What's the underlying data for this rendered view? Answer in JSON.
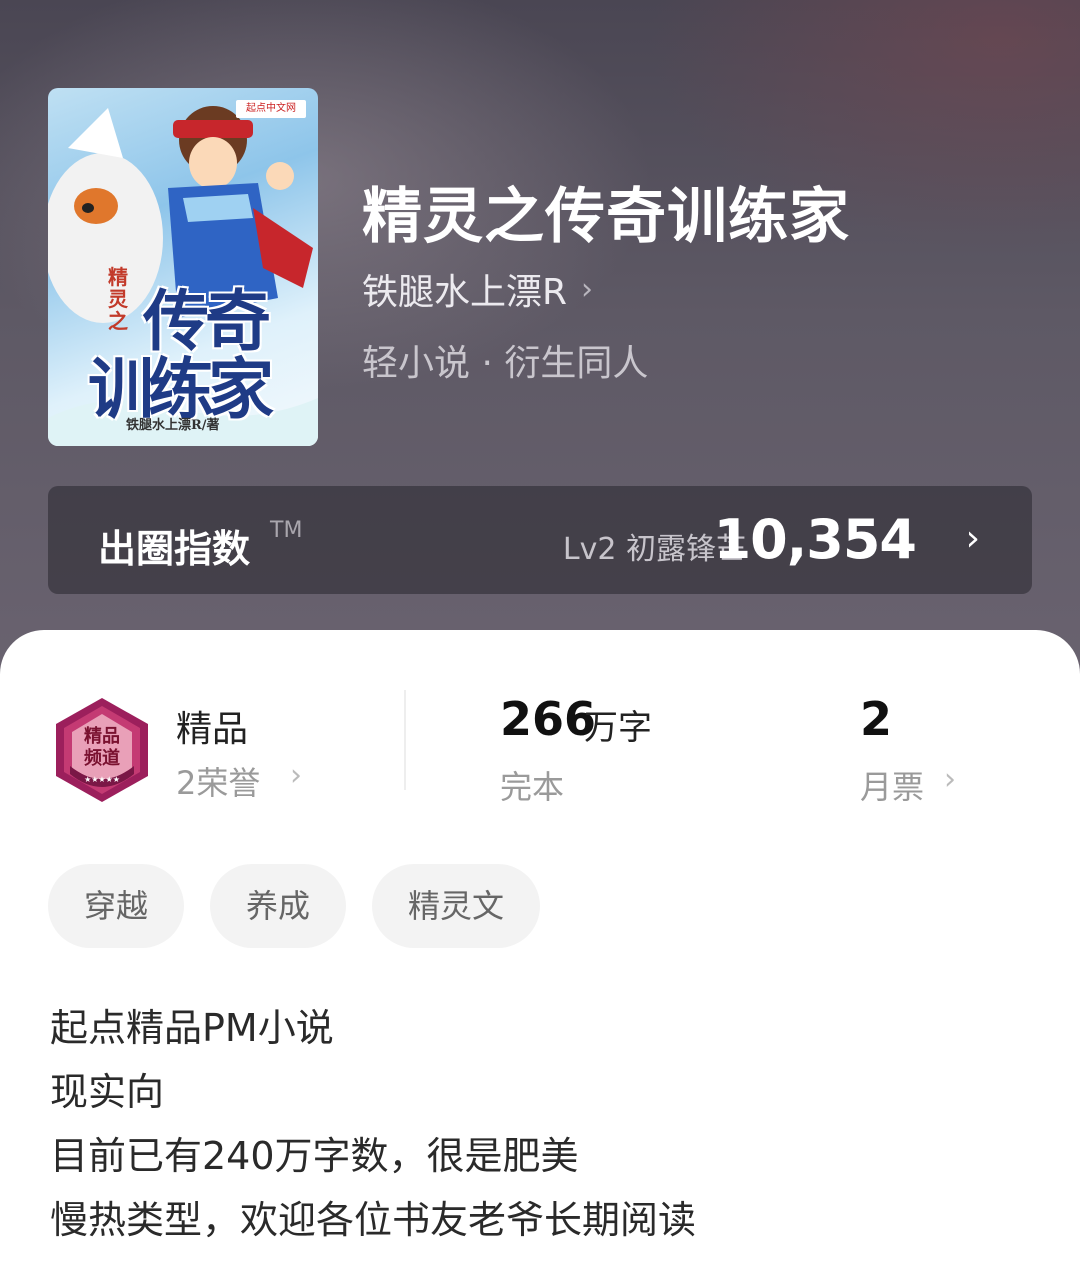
{
  "book": {
    "title": "精灵之传奇训练家",
    "author": "铁腿水上漂R",
    "genre": "轻小说 · 衍生同人"
  },
  "cover": {
    "publisher": "起点中文网",
    "small_title": "精灵之",
    "big_title_line1": "传奇",
    "big_title_line2": "训练家",
    "author_credit": "铁腿水上漂R/著"
  },
  "index": {
    "label": "出圈指数",
    "tm": "TM",
    "level": "Lv2 初露锋芒",
    "value": "10,354"
  },
  "stats": {
    "quality": {
      "label": "精品",
      "honors": "2荣誉",
      "badge_text": "精品频道"
    },
    "words": {
      "number": "266",
      "unit": "万字",
      "status": "完本"
    },
    "monthly_ticket": {
      "number": "2",
      "label": "月票"
    }
  },
  "tags": [
    "穿越",
    "养成",
    "精灵文"
  ],
  "description": [
    "起点精品PM小说",
    "现实向",
    "目前已有240万字数，很是肥美",
    "慢热类型，欢迎各位书友老爷长期阅读"
  ],
  "colors": {
    "header_bg": "#5a5560",
    "panel_bg": "#ffffff",
    "tag_bg": "#f3f3f3",
    "badge": "#b3246a"
  },
  "icons": {
    "chevron": "›"
  }
}
